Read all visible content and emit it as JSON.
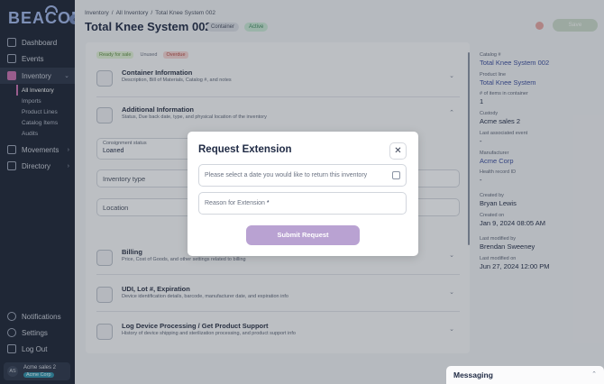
{
  "sidebar": {
    "logo": "BEACON",
    "nav": [
      {
        "label": "Dashboard",
        "icon": "dashboard-icon"
      },
      {
        "label": "Events",
        "icon": "calendar-icon"
      },
      {
        "label": "Inventory",
        "icon": "inventory-icon"
      },
      {
        "label": "Movements",
        "icon": "movements-icon"
      },
      {
        "label": "Directory",
        "icon": "directory-icon"
      }
    ],
    "inventory_sub": [
      "All Inventory",
      "Imports",
      "Product Lines",
      "Catalog Items",
      "Audits"
    ],
    "bottom": [
      {
        "label": "Notifications",
        "icon": "bell-icon"
      },
      {
        "label": "Settings",
        "icon": "gear-icon"
      },
      {
        "label": "Log Out",
        "icon": "logout-icon"
      }
    ],
    "user": {
      "initials": "AS",
      "name": "Acme sales 2",
      "org": "Acme Corp"
    }
  },
  "header": {
    "breadcrumb": [
      "Inventory",
      "All Inventory",
      "Total Knee System 002"
    ],
    "title": "Total Knee System 002",
    "chips": [
      "Container",
      "Active"
    ],
    "save_label": "Save"
  },
  "status_tags": [
    "Ready for sale",
    "Unused",
    "Overdue"
  ],
  "sections": {
    "container": {
      "title": "Container Information",
      "desc": "Description, Bill of Materials, Catalog #, and notes"
    },
    "additional": {
      "title": "Additional Information",
      "desc": "Status, Due back date, type, and physical location of the inventory"
    },
    "billing": {
      "title": "Billing",
      "desc": "Price, Cost of Goods, and other settings related to billing"
    },
    "udi": {
      "title": "UDI, Lot #, Expiration",
      "desc": "Device identification details, barcode, manufacturer date, and expiration info"
    },
    "log": {
      "title": "Log Device Processing / Get Product Support",
      "desc": "History of device shipping and sterilization processing, and product support info"
    }
  },
  "fields": {
    "consignment_label": "Consignment status",
    "consignment_value": "Loaned",
    "inventory_type_placeholder": "Inventory type",
    "location_placeholder": "Location"
  },
  "details": {
    "catalog_label": "Catalog #",
    "catalog_value": "Total Knee System 002",
    "product_line_label": "Product line",
    "product_line_value": "Total Knee System",
    "items_label": "# of items in container",
    "items_value": "1",
    "custody_label": "Custody",
    "custody_value": "Acme sales 2",
    "last_event_label": "Last associated event",
    "last_event_value": "-",
    "manufacturer_label": "Manufacturer",
    "manufacturer_value": "Acme Corp",
    "health_label": "Health record ID",
    "health_value": "-",
    "created_by_label": "Created by",
    "created_by_value": "Bryan Lewis",
    "created_on_label": "Created on",
    "created_on_value": "Jan 9, 2024 08:05 AM",
    "modified_by_label": "Last modified by",
    "modified_by_value": "Brendan Sweeney",
    "modified_on_label": "Last modified on",
    "modified_on_value": "Jun 27, 2024 12:00 PM"
  },
  "messaging": {
    "title": "Messaging"
  },
  "modal": {
    "title": "Request Extension",
    "date_placeholder": "Please select a date you would like to return this inventory",
    "reason_placeholder": "Reason for Extension",
    "reason_required_mark": "*",
    "submit_label": "Submit Request"
  },
  "colors": {
    "accent": "#c56fae",
    "sidebar_bg": "#1c2535",
    "link": "#3a4d9c",
    "submit": "#b9a2d2"
  }
}
